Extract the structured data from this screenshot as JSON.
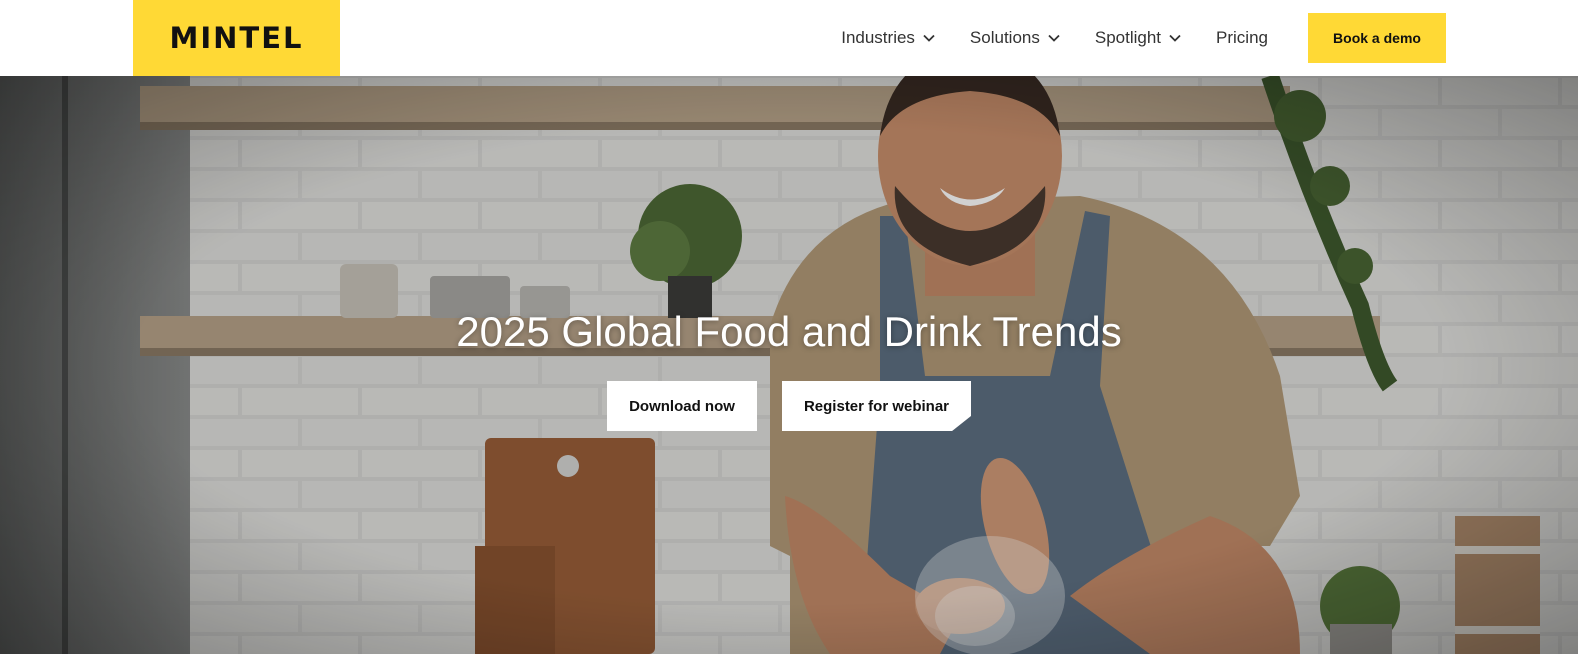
{
  "brand": {
    "logo_text": "MINTEL",
    "accent_color": "#ffd935"
  },
  "nav": {
    "items": [
      {
        "label": "Industries",
        "has_dropdown": true
      },
      {
        "label": "Solutions",
        "has_dropdown": true
      },
      {
        "label": "Spotlight",
        "has_dropdown": true
      },
      {
        "label": "Pricing",
        "has_dropdown": false
      }
    ],
    "cta_label": "Book a demo"
  },
  "hero": {
    "title": "2025 Global Food and Drink Trends",
    "primary_button": "Download now",
    "secondary_button": "Register for webinar",
    "image": "chef-clapping-flour-in-kitchen"
  }
}
